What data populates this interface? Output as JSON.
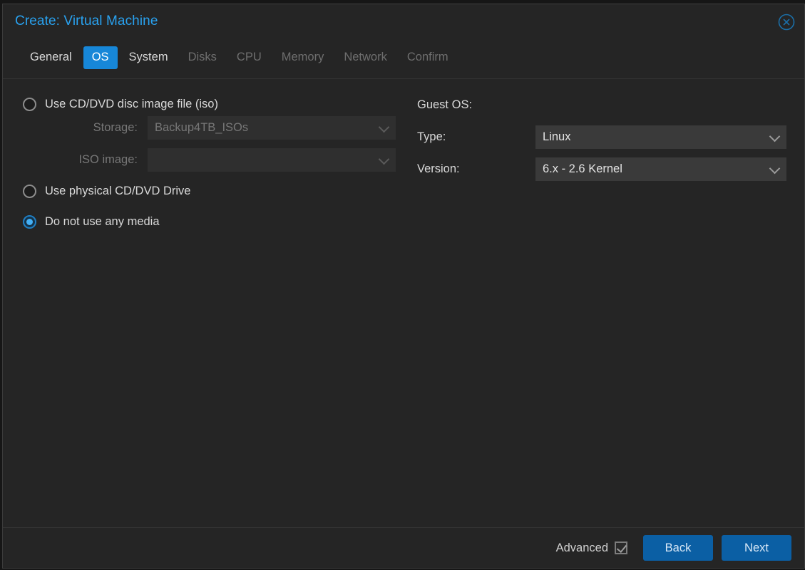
{
  "dialog": {
    "title": "Create: Virtual Machine",
    "close_icon": "close-circle-icon"
  },
  "tabs": [
    {
      "label": "General",
      "state": "enabled"
    },
    {
      "label": "OS",
      "state": "active"
    },
    {
      "label": "System",
      "state": "enabled"
    },
    {
      "label": "Disks",
      "state": "disabled"
    },
    {
      "label": "CPU",
      "state": "disabled"
    },
    {
      "label": "Memory",
      "state": "disabled"
    },
    {
      "label": "Network",
      "state": "disabled"
    },
    {
      "label": "Confirm",
      "state": "disabled"
    }
  ],
  "media": {
    "option_iso": "Use CD/DVD disc image file (iso)",
    "option_physical": "Use physical CD/DVD Drive",
    "option_none": "Do not use any media",
    "selected": "none",
    "storage_label": "Storage:",
    "storage_value": "Backup4TB_ISOs",
    "iso_label": "ISO image:",
    "iso_value": ""
  },
  "guest_os": {
    "heading": "Guest OS:",
    "type_label": "Type:",
    "type_value": "Linux",
    "version_label": "Version:",
    "version_value": "6.x - 2.6 Kernel"
  },
  "footer": {
    "advanced_label": "Advanced",
    "advanced_checked": true,
    "back_label": "Back",
    "next_label": "Next"
  },
  "colors": {
    "accent_tab": "#1787d8",
    "accent_button": "#0b5fa4",
    "title_text": "#29a2f0",
    "radio_selected": "#45b0f5"
  }
}
